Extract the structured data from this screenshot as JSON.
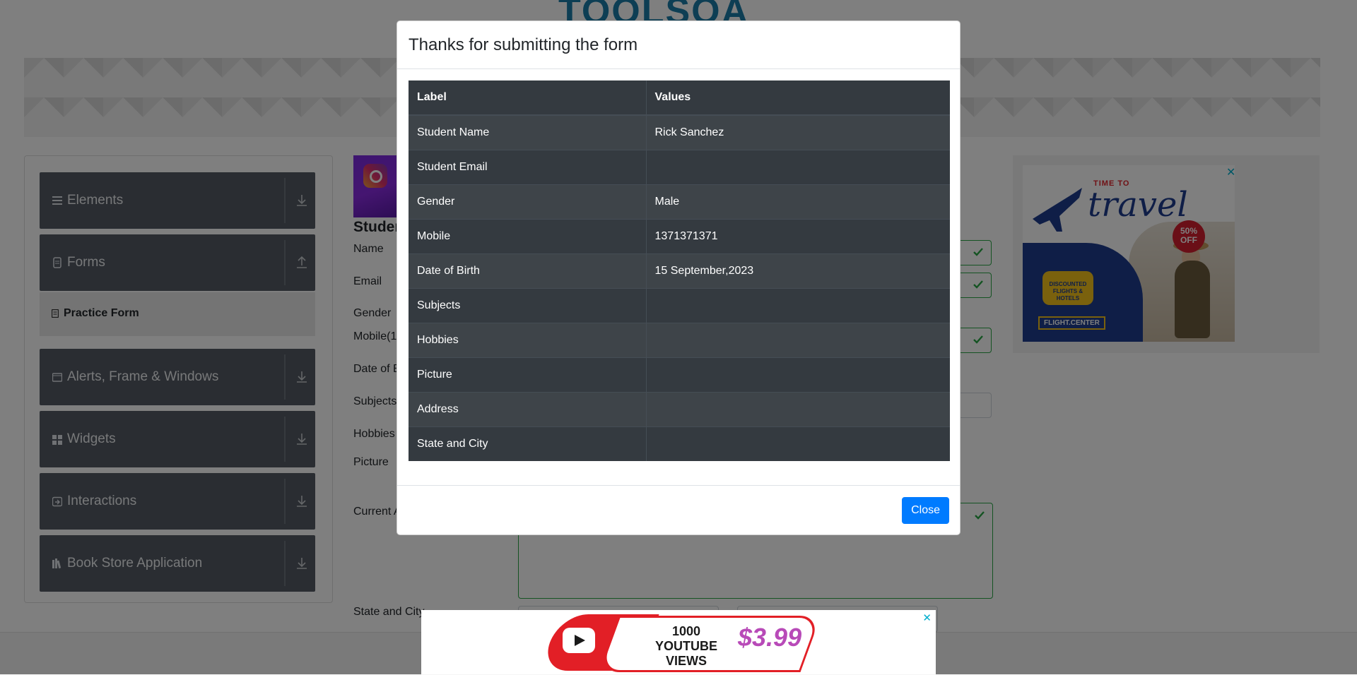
{
  "site": {
    "logo_text": "TOOLSQA"
  },
  "sidebar": {
    "groups": [
      {
        "label": "Elements",
        "icon": "bars-icon",
        "arrow": "chevron-down-icon"
      },
      {
        "label": "Forms",
        "icon": "document-icon",
        "arrow": "chevron-up-icon"
      },
      {
        "label": "Alerts, Frame & Windows",
        "icon": "window-icon",
        "arrow": "chevron-down-icon"
      },
      {
        "label": "Widgets",
        "icon": "widgets-icon",
        "arrow": "chevron-down-icon"
      },
      {
        "label": "Interactions",
        "icon": "interactions-icon",
        "arrow": "chevron-down-icon"
      },
      {
        "label": "Book Store Application",
        "icon": "books-icon",
        "arrow": "chevron-down-icon"
      }
    ],
    "active_item": "Practice Form"
  },
  "form": {
    "title": "Studen",
    "labels": {
      "name": "Name",
      "email": "Email",
      "gender": "Gender",
      "mobile": "Mobile(1",
      "dob": "Date of B",
      "subjects": "Subjects",
      "hobbies": "Hobbies",
      "picture": "Picture",
      "address": "Current A",
      "state_city": "State and City"
    }
  },
  "ads": {
    "right": {
      "line1": "TIME TO",
      "line2": "travel",
      "badge": "50% OFF",
      "bubble": "DISCOUNTED FLIGHTS & HOTELS",
      "brand": "FLIGHT.CENTER",
      "close": "✕"
    },
    "bottom": {
      "line1": "1000",
      "line2": "YOUTUBE VIEWS",
      "price": "$3.99",
      "close": "✕"
    }
  },
  "modal": {
    "title": "Thanks for submitting the form",
    "columns": [
      "Label",
      "Values"
    ],
    "rows": [
      {
        "label": "Student Name",
        "value": "Rick Sanchez"
      },
      {
        "label": "Student Email",
        "value": ""
      },
      {
        "label": "Gender",
        "value": "Male"
      },
      {
        "label": "Mobile",
        "value": "1371371371"
      },
      {
        "label": "Date of Birth",
        "value": "15 September,2023"
      },
      {
        "label": "Subjects",
        "value": ""
      },
      {
        "label": "Hobbies",
        "value": ""
      },
      {
        "label": "Picture",
        "value": ""
      },
      {
        "label": "Address",
        "value": ""
      },
      {
        "label": "State and City",
        "value": ""
      }
    ],
    "close_label": "Close"
  },
  "colors": {
    "primary": "#007bff",
    "table_dark": "#343a40",
    "sidebar_header": "#545b64",
    "valid_green": "#28a745"
  }
}
